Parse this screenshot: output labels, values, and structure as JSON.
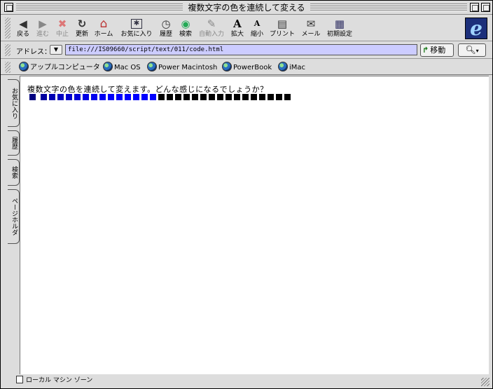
{
  "window": {
    "title": "複数文字の色を連続して変える"
  },
  "toolbar": {
    "back": "戻る",
    "forward": "進む",
    "stop": "中止",
    "refresh": "更新",
    "home": "ホーム",
    "favorites": "お気に入り",
    "history": "履歴",
    "search": "検索",
    "autofill": "自動入力",
    "larger": "拡大",
    "smaller": "縮小",
    "print": "プリント",
    "mail": "メール",
    "preferences": "初期設定",
    "logo": "e"
  },
  "address": {
    "label": "アドレス：",
    "url": "file:///IS09660/script/text/011/code.html",
    "go_label": "移動"
  },
  "favorites_bar": [
    "アップルコンピュータ",
    "Mac OS",
    "Power Macintosh",
    "PowerBook",
    "iMac"
  ],
  "side_tabs": [
    "お気に入り",
    "履歴",
    "検索",
    "ページホルダ"
  ],
  "page": {
    "text": "複数文字の色を連続して変えます。どんな感じになるでしょうか？",
    "squares": [
      "#000080",
      "#0000a0",
      "#0000b4",
      "#0000c0",
      "#0000cc",
      "#0000d8",
      "#0000e4",
      "#0000ee",
      "#0000f4",
      "#0000fa",
      "#0000ff",
      "#0000ff",
      "#0000ff",
      "#0000ff",
      "#0000ff",
      "#000000",
      "#000000",
      "#000000",
      "#000000",
      "#000000",
      "#000000",
      "#000000",
      "#000000",
      "#000000",
      "#000000",
      "#000000",
      "#000000",
      "#000000",
      "#000000",
      "#000000",
      "#000000"
    ]
  },
  "status": {
    "zone": "ローカル マシン ゾーン"
  },
  "icons": {
    "back": "◀",
    "forward": "▶",
    "stop": "✖",
    "refresh": "↻",
    "home": "⌂",
    "favorites": "✱",
    "history": "◷",
    "search": "◉",
    "autofill": "✎",
    "larger": "A",
    "smaller": "A",
    "print": "▤",
    "mail": "✉",
    "preferences": "▦"
  }
}
